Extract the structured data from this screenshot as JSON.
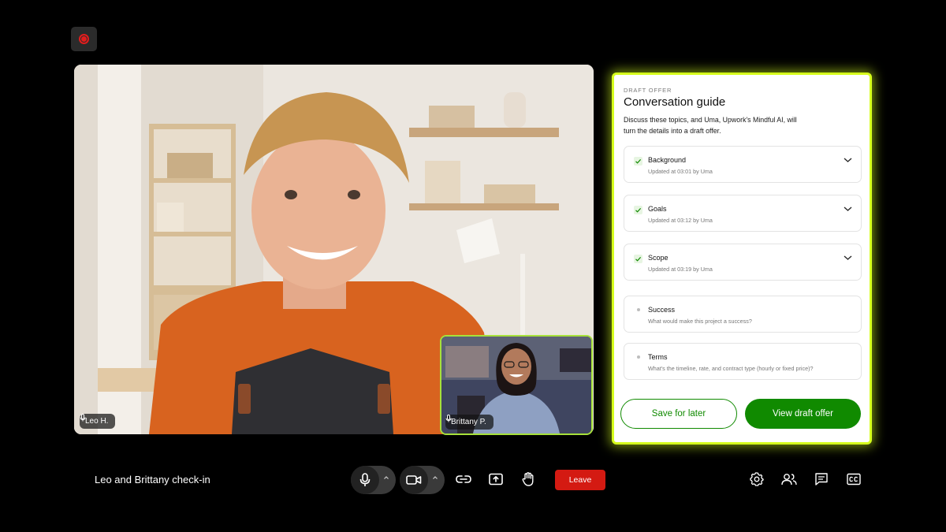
{
  "recording": {
    "icon": "record-icon",
    "color": "#e11d1d"
  },
  "participants": {
    "main": {
      "name": "Leo H."
    },
    "pip": {
      "name": "Brittany P.",
      "border_color": "#a7e13a"
    }
  },
  "panel": {
    "eyebrow": "DRAFT OFFER",
    "title": "Conversation guide",
    "description": "Discuss these topics, and Uma, Upwork's Mindful AI, will turn the details into a draft offer.",
    "highlight_color": "#d6ff1d",
    "topics": [
      {
        "title": "Background",
        "subtitle": "Updated at 03:01 by Uma",
        "status": "done"
      },
      {
        "title": "Goals",
        "subtitle": "Updated at 03:12 by Uma",
        "status": "done"
      },
      {
        "title": "Scope",
        "subtitle": "Updated at 03:19 by Uma",
        "status": "done"
      },
      {
        "title": "Success",
        "subtitle": "What would make this project a success?",
        "status": "pending"
      },
      {
        "title": "Terms",
        "subtitle": "What's the timeline, rate, and contract type (hourly or fixed price)?",
        "status": "pending"
      }
    ],
    "save_label": "Save for later",
    "view_label": "View draft offer",
    "accent_color": "#108a00"
  },
  "toolbar": {
    "meeting_title": "Leo and Brittany check-in",
    "leave_label": "Leave",
    "leave_color": "#d41a12",
    "icons": [
      "microphone-icon",
      "camera-icon",
      "link-icon",
      "share-screen-icon",
      "raise-hand-icon",
      "settings-icon",
      "participants-icon",
      "chat-icon",
      "captions-icon"
    ]
  }
}
